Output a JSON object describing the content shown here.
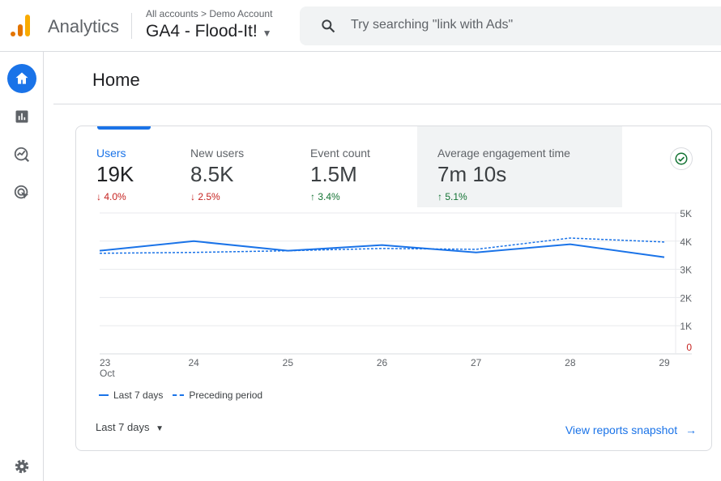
{
  "header": {
    "brand": "Analytics",
    "breadcrumb": "All accounts > Demo Account",
    "property": "GA4 - Flood-It!",
    "search_placeholder": "Try searching \"link with Ads\""
  },
  "sidebar": {
    "items": [
      {
        "icon": "home-icon",
        "active": true
      },
      {
        "icon": "reports-icon"
      },
      {
        "icon": "explore-icon"
      },
      {
        "icon": "advertising-icon"
      }
    ],
    "settings_icon": "gear-icon"
  },
  "page": {
    "title": "Home"
  },
  "metrics": [
    {
      "name": "Users",
      "value": "19K",
      "delta": "4.0%",
      "direction": "down"
    },
    {
      "name": "New users",
      "value": "8.5K",
      "delta": "2.5%",
      "direction": "down"
    },
    {
      "name": "Event count",
      "value": "1.5M",
      "delta": "3.4%",
      "direction": "up"
    },
    {
      "name": "Average engagement time",
      "value": "7m 10s",
      "delta": "5.1%",
      "direction": "up"
    }
  ],
  "chart_data": {
    "type": "line",
    "categories": [
      "23",
      "24",
      "25",
      "26",
      "27",
      "28",
      "29"
    ],
    "x_sublabel": "Oct",
    "yticks": [
      "0",
      "1K",
      "2K",
      "3K",
      "4K",
      "5K"
    ],
    "ylim": [
      0,
      5000
    ],
    "grid": true,
    "legend_placement": "bottom-left",
    "series": [
      {
        "name": "Last 7 days",
        "style": "solid",
        "color": "#1a73e8",
        "values": [
          3660,
          4000,
          3660,
          3860,
          3600,
          3890,
          3430
        ]
      },
      {
        "name": "Preceding period",
        "style": "dashed",
        "color": "#1a73e8",
        "values": [
          3570,
          3600,
          3660,
          3740,
          3710,
          4110,
          3970
        ]
      }
    ]
  },
  "footer": {
    "range": "Last 7 days",
    "snapshot_link": "View reports snapshot"
  }
}
